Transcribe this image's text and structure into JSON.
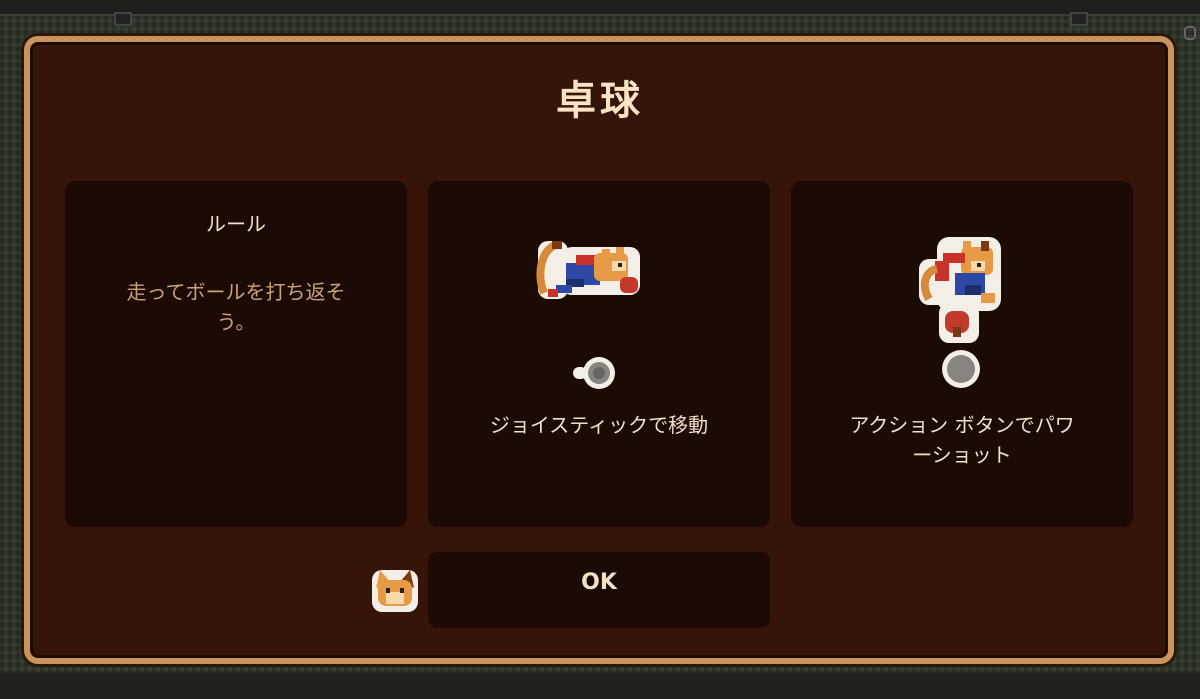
{
  "dialog": {
    "title": "卓球",
    "ok_label": "OK"
  },
  "cards": {
    "rules": {
      "heading": "ルール",
      "body_line1": "走ってボールを打ち返そ",
      "body_line2": "う。"
    },
    "move": {
      "caption": "ジョイスティックで移動",
      "sprite": "cat-player-running-icon",
      "indicator": "joystick-icon"
    },
    "action": {
      "caption_line1": "アクション ボタンでパワ",
      "caption_line2": "ーショット",
      "sprite": "cat-player-jumping-icon",
      "indicator": "action-button-icon"
    }
  },
  "footer": {
    "avatar": "cat-face-icon"
  },
  "colors": {
    "panel_bg": "#371409",
    "panel_border": "#c9955b",
    "card_bg": "#1c0a05",
    "title_text": "#f6e4c3",
    "body_text": "#c9a27a"
  }
}
